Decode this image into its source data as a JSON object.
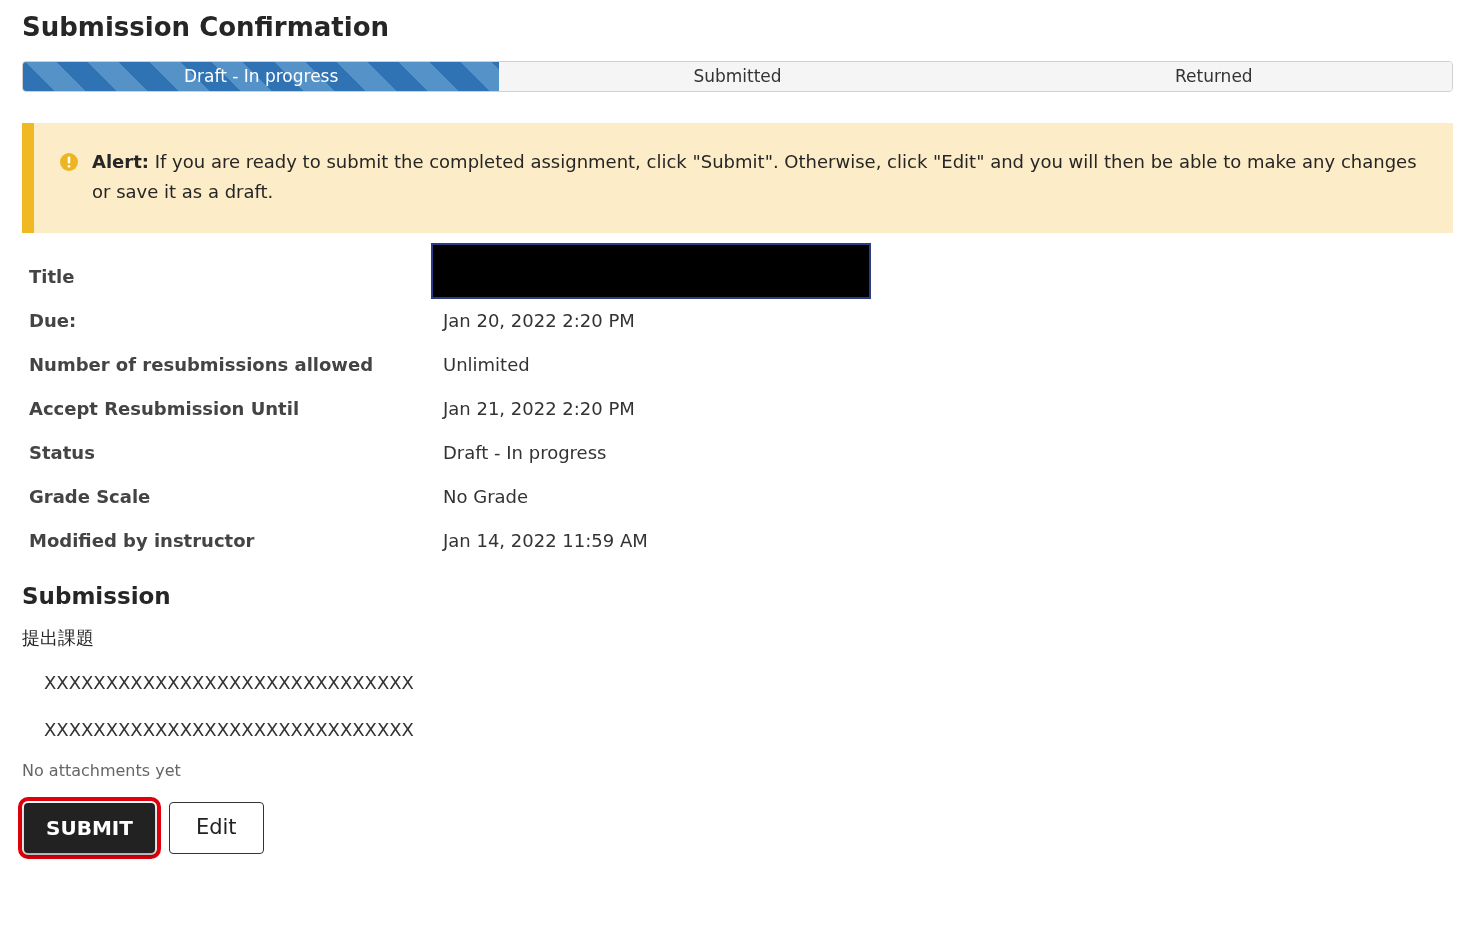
{
  "page_title": "Submission Confirmation",
  "progress_steps": [
    {
      "label": "Draft - In progress",
      "selected": true
    },
    {
      "label": "Submitted",
      "selected": false
    },
    {
      "label": "Returned",
      "selected": false
    }
  ],
  "alert": {
    "text": "**Alert:** If you are ready to submit the completed assignment, click \"Submit\". Otherwise, click \"Edit\" and you will then be able to make any changes or save it as a draft."
  },
  "details": [
    {
      "label": "Title",
      "redacted": true
    },
    {
      "label": "Due:",
      "value": "Jan 20, 2022 2:20 PM"
    },
    {
      "label": "Number of resubmissions allowed",
      "value": "Unlimited"
    },
    {
      "label": "Accept Resubmission Until",
      "value": "Jan 21, 2022 2:20 PM"
    },
    {
      "label": "Status",
      "value": "Draft - In progress"
    },
    {
      "label": "Grade Scale",
      "value": "No Grade"
    },
    {
      "label": "Modified by instructor",
      "value": "Jan 14, 2022 11:59 AM"
    }
  ],
  "submission": {
    "heading": "Submission",
    "subheading": "提出課題",
    "lines": [
      "XXXXXXXXXXXXXXXXXXXXXXXXXXXXXX",
      "XXXXXXXXXXXXXXXXXXXXXXXXXXXXXX"
    ],
    "attachments_note": "No attachments yet"
  },
  "buttons": [
    {
      "label": "SUBMIT",
      "kind": "primary",
      "highlighted": true
    },
    {
      "label": "Edit",
      "kind": "secondary",
      "highlighted": false
    }
  ]
}
